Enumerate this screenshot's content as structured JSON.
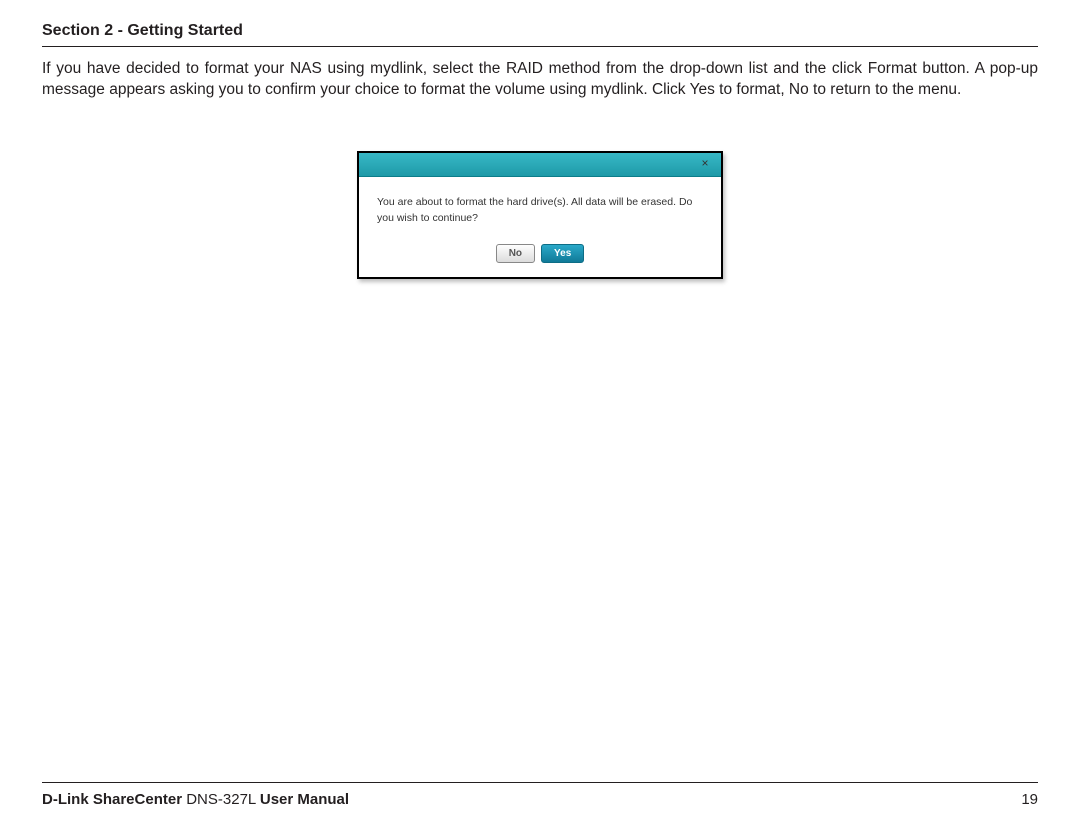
{
  "header": {
    "section_title": "Section 2 - Getting Started"
  },
  "body": {
    "paragraph": "If you have decided to format your NAS using mydlink, select the RAID method from the drop-down list and the click Format button. A pop-up message appears asking you to confirm your choice to format the volume using mydlink. Click Yes to format, No to return to the menu."
  },
  "dialog": {
    "close_glyph": "×",
    "message": "You are about to format the hard drive(s). All data will be erased. Do you wish to continue?",
    "no_label": "No",
    "yes_label": "Yes"
  },
  "footer": {
    "brand_bold1": "D-Link ShareCenter",
    "model": " DNS-327L ",
    "brand_bold2": "User Manual",
    "page_number": "19"
  }
}
